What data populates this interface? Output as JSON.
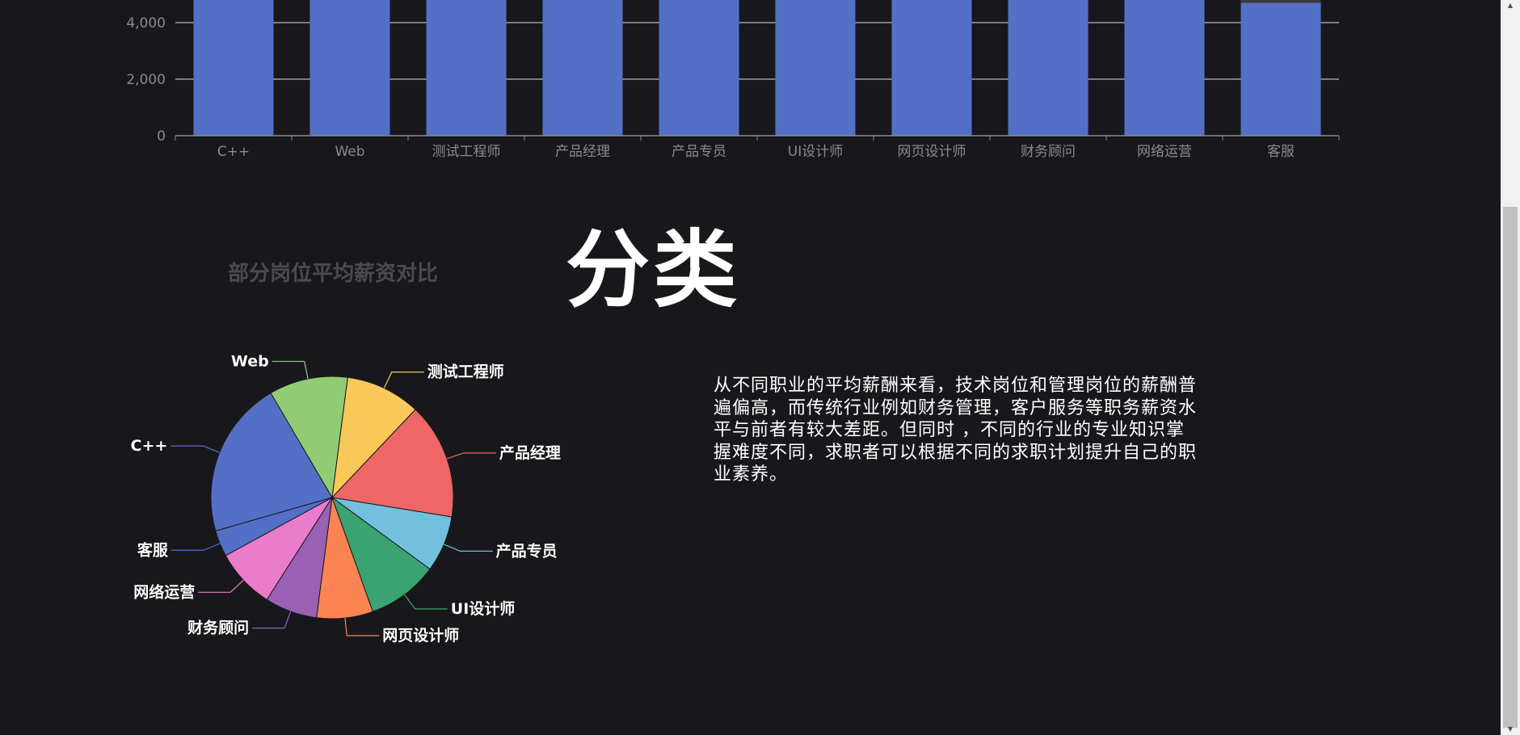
{
  "bar_chart": {
    "chart_data": {
      "type": "bar",
      "categories": [
        "C++",
        "Web",
        "测试工程师",
        "产品经理",
        "产品专员",
        "UI设计师",
        "网页设计师",
        "财务顾问",
        "网络运营",
        "客服"
      ],
      "values": [
        5000,
        5000,
        5000,
        5000,
        5000,
        5000,
        5000,
        5000,
        5000,
        4700
      ],
      "y_ticks": [
        "0",
        "2,000",
        "4,000"
      ],
      "grid": true
    },
    "bar_color": "#5470c6",
    "shadow_color": "#3a3a40"
  },
  "pie_chart": {
    "title": "部分岗位平均薪资对比",
    "chart_data": {
      "type": "pie",
      "categories": [
        "C++",
        "Web",
        "测试工程师",
        "产品经理",
        "产品专员",
        "UI设计师",
        "网页设计师",
        "财务顾问",
        "网络运营",
        "客服"
      ],
      "values": [
        21,
        10.5,
        10,
        15.5,
        7.5,
        9.5,
        7.5,
        7,
        8,
        3.5
      ],
      "colors": [
        "#5470c6",
        "#91cc75",
        "#fac858",
        "#ee6666",
        "#73c0de",
        "#3ba272",
        "#fc8452",
        "#9a60b4",
        "#ea7ccc",
        "#5470c6"
      ]
    }
  },
  "section": {
    "title": "分类",
    "description": "从不同职业的平均薪酬来看，技术岗位和管理岗位的薪酬普遍偏高，而传统行业例如财务管理，客户服务等职务薪资水平与前者有较大差距。但同时 ，不同的行业的专业知识掌握难度不同，求职者可以根据不同的求职计划提升自己的职业素养。"
  },
  "scrollbar": {
    "up_arrow": "▲",
    "down_arrow": "▼"
  }
}
